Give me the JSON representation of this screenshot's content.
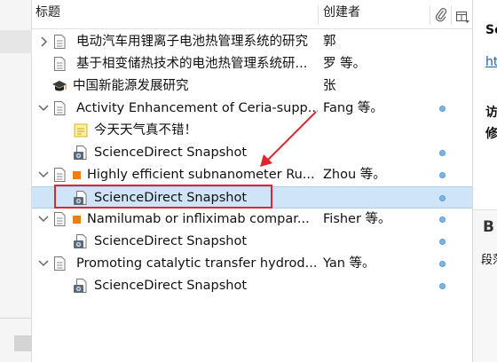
{
  "columns": {
    "title": "标题",
    "creator": "创建者",
    "attachment_icon": "paperclip-icon",
    "extra_icon": "column-picker-icon"
  },
  "items": [
    {
      "title": "电动汽车用锂离子电池热管理系统的研究",
      "creator": "郭",
      "icon": "document-icon",
      "twisty": "collapsed",
      "level": 0,
      "dot": false
    },
    {
      "title": "基于相变储热技术的电池热管理系统研...",
      "creator": "罗 等。",
      "icon": "document-icon",
      "twisty": "none",
      "level": 0,
      "dot": false
    },
    {
      "title": "中国新能源发展研究",
      "creator": "张",
      "icon": "thesis-cap-icon",
      "twisty": "none",
      "level": 0,
      "dot": false
    },
    {
      "title": "Activity Enhancement of Ceria-supp...",
      "creator": "Fang 等。",
      "icon": "document-icon",
      "twisty": "expanded",
      "level": 0,
      "dot": true
    },
    {
      "title": "今天天气真不错！",
      "creator": "",
      "icon": "note-icon",
      "twisty": "none",
      "level": 1,
      "dot": false
    },
    {
      "title": "ScienceDirect Snapshot",
      "creator": "",
      "icon": "snapshot-icon",
      "twisty": "none",
      "level": 1,
      "dot": true
    },
    {
      "title": "Highly efficient subnanometer Ru...",
      "creator": "Zhou 等。",
      "icon": "document-icon",
      "twisty": "expanded",
      "level": 0,
      "dot": true,
      "tag": true
    },
    {
      "title": "ScienceDirect Snapshot",
      "creator": "",
      "icon": "snapshot-icon",
      "twisty": "none",
      "level": 1,
      "dot": true,
      "selected": true
    },
    {
      "title": "Namilumab or infliximab compar...",
      "creator": "Fisher 等。",
      "icon": "document-icon",
      "twisty": "expanded",
      "level": 0,
      "dot": true,
      "tag": true
    },
    {
      "title": "ScienceDirect Snapshot",
      "creator": "",
      "icon": "snapshot-icon",
      "twisty": "none",
      "level": 1,
      "dot": true
    },
    {
      "title": "Promoting catalytic transfer hydrod...",
      "creator": "Yan 等。",
      "icon": "document-icon",
      "twisty": "expanded",
      "level": 0,
      "dot": true
    },
    {
      "title": "ScienceDirect Snapshot",
      "creator": "",
      "icon": "snapshot-icon",
      "twisty": "none",
      "level": 1,
      "dot": true
    }
  ],
  "right_panel": {
    "heading": "Sc",
    "link": "ht",
    "line1": "访",
    "line2": "修",
    "bold_glyph": "B",
    "para": "段落"
  },
  "colors": {
    "selection": "#cfe5f7",
    "highlight_box": "#e0262c",
    "tag": "#f07d12",
    "dot": "#7db6e4",
    "link": "#1a5fb4"
  }
}
